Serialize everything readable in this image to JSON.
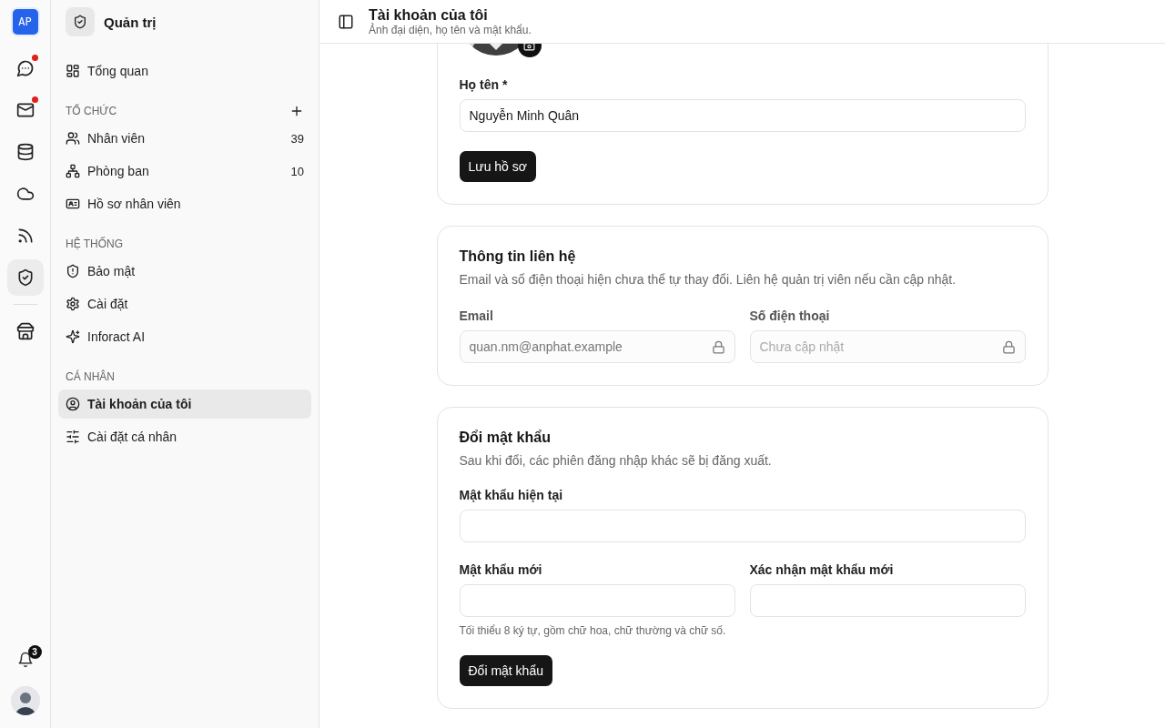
{
  "rail": {
    "logo": "AP",
    "items": [
      {
        "kind": "chat",
        "selected": false,
        "unread": true
      },
      {
        "kind": "mail",
        "selected": false,
        "unread": true
      },
      {
        "kind": "database",
        "selected": false,
        "unread": false
      },
      {
        "kind": "cloud",
        "selected": false,
        "unread": false
      },
      {
        "kind": "rss",
        "selected": false,
        "unread": false
      },
      {
        "kind": "shield",
        "selected": true,
        "unread": false
      }
    ],
    "extra_items": [
      {
        "kind": "store",
        "selected": false,
        "unread": false
      }
    ],
    "notifications": {
      "count": "3"
    }
  },
  "sidebar": {
    "title": "Quản trị",
    "top_items": [
      {
        "kind": "grid",
        "label": "Tổng quan",
        "selected": false
      }
    ],
    "sections": [
      {
        "title": "TỔ CHỨC",
        "can_add": true,
        "items": [
          {
            "kind": "users",
            "label": "Nhân viên",
            "count": "39",
            "selected": false
          },
          {
            "kind": "network",
            "label": "Phòng ban",
            "count": "10",
            "selected": false
          },
          {
            "kind": "idcard",
            "label": "Hồ sơ nhân viên",
            "selected": false
          }
        ]
      },
      {
        "title": "HỆ THỐNG",
        "can_add": false,
        "items": [
          {
            "kind": "shieldalert",
            "label": "Bảo mật",
            "selected": false
          },
          {
            "kind": "gear",
            "label": "Cài đặt",
            "selected": false
          },
          {
            "kind": "sparkles",
            "label": "Inforact AI",
            "selected": false
          }
        ]
      },
      {
        "title": "CÁ NHÂN",
        "can_add": false,
        "items": [
          {
            "kind": "usercircle",
            "label": "Tài khoản của tôi",
            "selected": true
          },
          {
            "kind": "sliders",
            "label": "Cài đặt cá nhân",
            "selected": false
          }
        ]
      }
    ]
  },
  "header": {
    "title": "Tài khoản của tôi",
    "subtitle": "Ảnh đại diện, họ tên và mật khẩu."
  },
  "profile_card": {
    "name_label": "Họ tên *",
    "name_value": "Nguyễn Minh Quân",
    "save_button": "Lưu hồ sơ"
  },
  "contact_card": {
    "title": "Thông tin liên hệ",
    "description": "Email và số điện thoại hiện chưa thể tự thay đổi. Liên hệ quản trị viên nếu cần cập nhật.",
    "fields": [
      {
        "label": "Email",
        "value": "quan.nm@anphat.example",
        "locked": true
      },
      {
        "label": "Số điện thoại",
        "placeholder": "Chưa cập nhật",
        "locked": true
      }
    ]
  },
  "password_card": {
    "title": "Đổi mật khẩu",
    "description": "Sau khi đổi, các phiên đăng nhập khác sẽ bị đăng xuất.",
    "current_label": "Mật khẩu hiện tại",
    "new_label": "Mật khẩu mới",
    "confirm_label": "Xác nhận mật khẩu mới",
    "hint": "Tối thiểu 8 ký tự, gồm chữ hoa, chữ thường và chữ số.",
    "submit_button": "Đổi mật khẩu"
  }
}
